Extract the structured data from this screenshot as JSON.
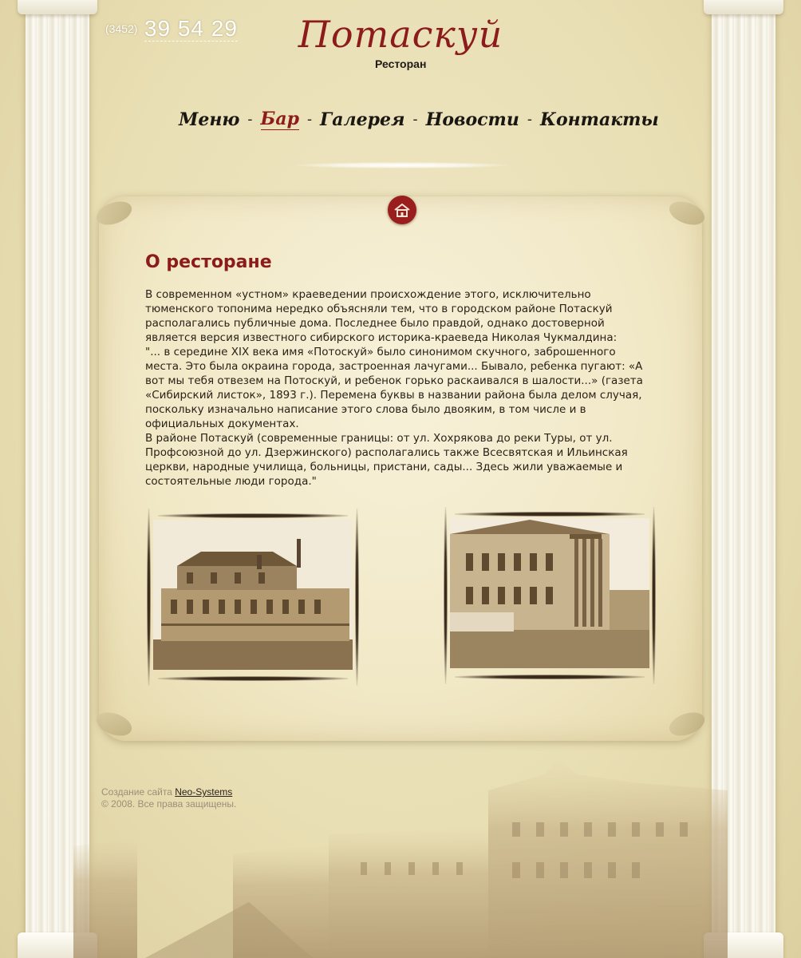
{
  "header": {
    "phone_code": "(3452)",
    "phone_number": "39 54 29",
    "logo_script": "Потаскуй",
    "logo_sub": "Ресторан"
  },
  "nav": {
    "items": [
      {
        "label": "Меню",
        "active": false
      },
      {
        "label": "Бар",
        "active": true
      },
      {
        "label": "Галерея",
        "active": false
      },
      {
        "label": "Новости",
        "active": false
      },
      {
        "label": "Контакты",
        "active": false
      }
    ],
    "separator": "-"
  },
  "content": {
    "title": "О ресторане",
    "paragraphs": [
      "В современном «устном» краеведении происхождение этого, исключительно тюменского топонима нередко объясняли тем, что в городском районе Потаскуй располагались публичные дома. Последнее было правдой, однако достоверной является версия известного сибирского историка-краеведа Николая Чукмалдина:",
      "\"... в середине XIX века имя «Потоскуй» было синонимом скучного, заброшенного места. Это была окраина города, застроенная лачугами... Бывало, ребенка пугают: «А вот мы тебя отвезем на Потоскуй, и ребенок горько раскаивался в шалости...» (газета «Сибирский листок», 1893 г.). Перемена буквы в названии района была делом случая, поскольку изначально написание этого слова было двояким, в том числе и в официальных документах.",
      "В районе Потаскуй (современные границы: от ул. Хохрякова до реки Туры, от ул. Профсоюзной до ул. Дзержинского) располагались также Всесвятская и Ильинская церкви, народные училища, больницы, пристани, сады... Здесь жили уважаемые и состоятельные люди города.\""
    ]
  },
  "footer": {
    "credit_prefix": "Создание сайта",
    "credit_link": "Neo-Systems",
    "copyright": "© 2008. Все права защищены."
  },
  "colors": {
    "accent": "#8c1b1b",
    "background": "#e9dfb4",
    "parchment": "#f3ebcc",
    "footer_text": "#9b8f78"
  },
  "icons": {
    "home": "home-icon"
  }
}
